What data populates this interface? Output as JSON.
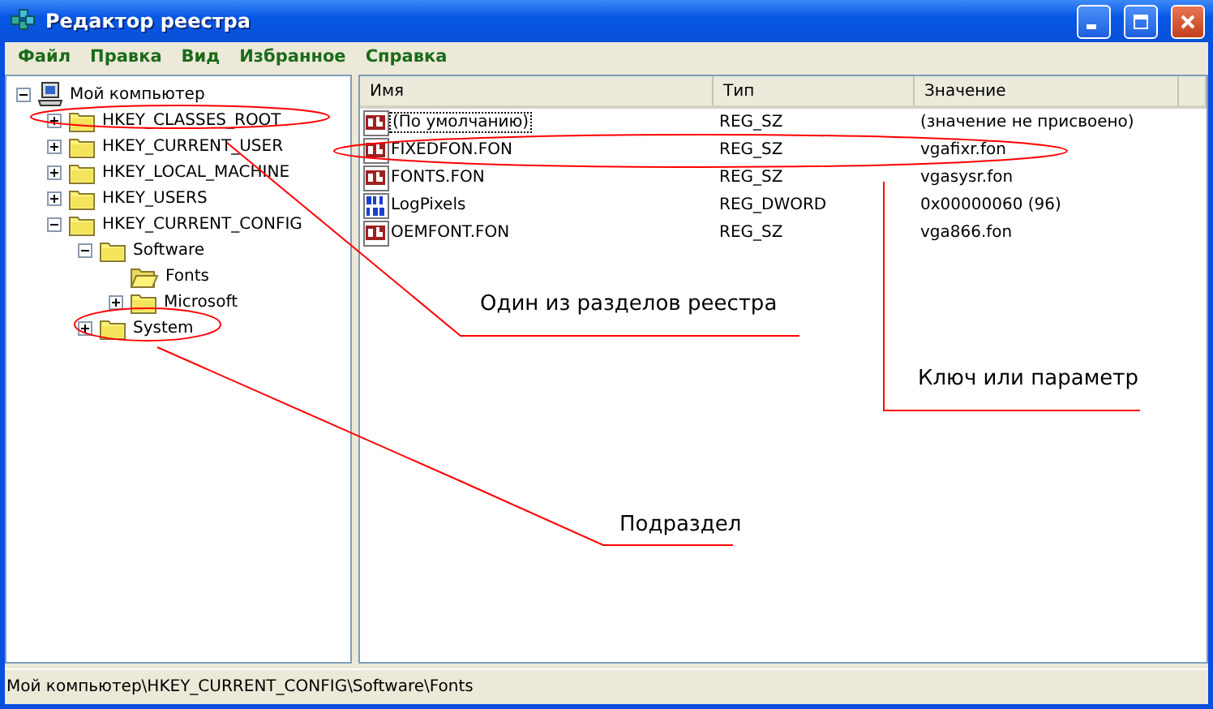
{
  "window": {
    "title": "Редактор реестра"
  },
  "menu": [
    "Файл",
    "Правка",
    "Вид",
    "Избранное",
    "Справка"
  ],
  "tree": [
    {
      "label": "Мой компьютер",
      "kind": "computer",
      "expanded": true,
      "selected": false,
      "children": [
        {
          "label": "HKEY_CLASSES_ROOT",
          "kind": "folder",
          "expanded": false,
          "selected": false
        },
        {
          "label": "HKEY_CURRENT_USER",
          "kind": "folder",
          "expanded": false,
          "selected": false
        },
        {
          "label": "HKEY_LOCAL_MACHINE",
          "kind": "folder",
          "expanded": false,
          "selected": false
        },
        {
          "label": "HKEY_USERS",
          "kind": "folder",
          "expanded": false,
          "selected": false
        },
        {
          "label": "HKEY_CURRENT_CONFIG",
          "kind": "folder",
          "expanded": true,
          "selected": false,
          "children": [
            {
              "label": "Software",
              "kind": "folder",
              "expanded": true,
              "selected": false,
              "children": [
                {
                  "label": "Fonts",
                  "kind": "folder",
                  "selected": true
                },
                {
                  "label": "Microsoft",
                  "kind": "folder",
                  "expanded": false,
                  "selected": false
                }
              ]
            },
            {
              "label": "System",
              "kind": "folder",
              "expanded": false,
              "selected": false
            }
          ]
        }
      ]
    }
  ],
  "list": {
    "columns": [
      "Имя",
      "Тип",
      "Значение"
    ],
    "rows": [
      {
        "name": "(По умолчанию)",
        "type": "REG_SZ",
        "value": "(значение не присвоено)",
        "kind": "string",
        "focused": true
      },
      {
        "name": "FIXEDFON.FON",
        "type": "REG_SZ",
        "value": "vgafixr.fon",
        "kind": "string",
        "focused": false
      },
      {
        "name": "FONTS.FON",
        "type": "REG_SZ",
        "value": "vgasysr.fon",
        "kind": "string",
        "focused": false
      },
      {
        "name": "LogPixels",
        "type": "REG_DWORD",
        "value": "0x00000060 (96)",
        "kind": "binary",
        "focused": false
      },
      {
        "name": "OEMFONT.FON",
        "type": "REG_SZ",
        "value": "vga866.fon",
        "kind": "string",
        "focused": false
      }
    ]
  },
  "callouts": [
    {
      "text": "Один из разделов реестра"
    },
    {
      "text": "Ключ или параметр"
    },
    {
      "text": "Подраздел"
    }
  ],
  "status_bar": "Мой компьютер\\HKEY_CURRENT_CONFIG\\Software\\Fonts"
}
